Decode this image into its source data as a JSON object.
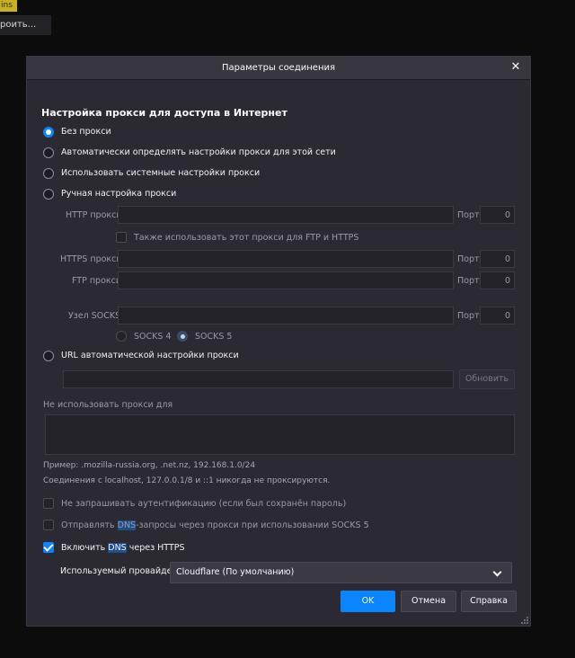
{
  "background": {
    "tag_text": "ins",
    "menu_text": "роить..."
  },
  "dialog": {
    "title": "Параметры соединения",
    "close_glyph": "✕",
    "heading": "Настройка прокси для доступа в Интернет",
    "options": {
      "no_proxy": "Без прокси",
      "auto_detect": "Автоматически определять настройки прокси для этой сети",
      "system": "Использовать системные настройки прокси",
      "manual": "Ручная настройка прокси"
    },
    "manual": {
      "http_label": "HTTP прокси",
      "http_value": "",
      "port_label": "Порт",
      "http_port": "0",
      "also_use_label": "Также использовать этот прокси для FTP и HTTPS",
      "https_label": "HTTPS прокси",
      "https_value": "",
      "https_port": "0",
      "ftp_label": "FTP прокси",
      "ftp_value": "",
      "ftp_port": "0",
      "socks_label": "Узел SOCKS",
      "socks_value": "",
      "socks_port": "0",
      "socks4_label": "SOCKS 4",
      "socks5_label": "SOCKS 5"
    },
    "auto_url": {
      "label": "URL автоматической настройки прокси",
      "value": "",
      "reload_label": "Обновить"
    },
    "no_proxy_for": {
      "label": "Не использовать прокси для",
      "value": "",
      "example": "Пример: .mozilla-russia.org, .net.nz, 192.168.1.0/24",
      "localhost_note": "Соединения с localhost, 127.0.0.1/8 и ::1 никогда не проксируются."
    },
    "checks": {
      "no_auth_prompt": "Не запрашивать аутентификацию (если был сохранён пароль)",
      "dns_socks_pre": "Отправлять ",
      "dns_socks_hl": "DNS",
      "dns_socks_post": "-запросы через прокси при использовании SOCKS 5",
      "doh_pre": "Включить ",
      "doh_hl": "DNS",
      "doh_post": " через HTTPS"
    },
    "provider": {
      "label": "Используемый провайдер",
      "selected": "Cloudflare (По умолчанию)"
    },
    "buttons": {
      "ok": "OK",
      "cancel": "Отмена",
      "help": "Справка"
    }
  }
}
